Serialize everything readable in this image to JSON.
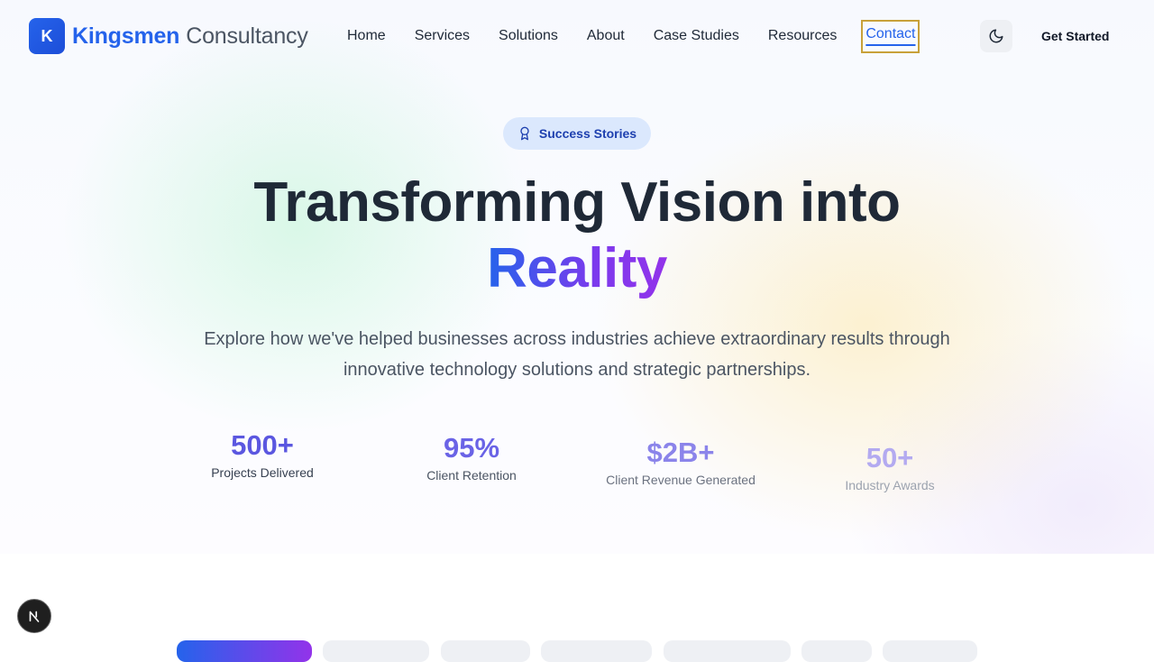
{
  "brand": {
    "mark": "K",
    "name_strong": "Kingsmen",
    "name_light": "Consultancy"
  },
  "nav": {
    "links": [
      "Home",
      "Services",
      "Solutions",
      "About",
      "Case Studies",
      "Resources"
    ],
    "active_link": "Contact",
    "theme_toggle_icon": "moon-icon",
    "cta": "Get Started"
  },
  "hero": {
    "badge_icon": "award-icon",
    "badge": "Success Stories",
    "headline_line1": "Transforming Vision into",
    "headline_line2": "Reality",
    "lead": "Explore how we've helped businesses across industries achieve extraordinary results through innovative technology solutions and strategic partnerships.",
    "stats": [
      {
        "value": "500+",
        "label": "Projects Delivered"
      },
      {
        "value": "95%",
        "label": "Client Retention"
      },
      {
        "value": "$2B+",
        "label": "Client Revenue Generated"
      },
      {
        "value": "50+",
        "label": "Industry Awards"
      }
    ]
  },
  "colors": {
    "accent": "#2563eb",
    "gradient_end": "#9333ea",
    "text_dark": "#1f2937",
    "text_muted": "#4b5563"
  },
  "floating_button_icon": "next-logo-icon"
}
